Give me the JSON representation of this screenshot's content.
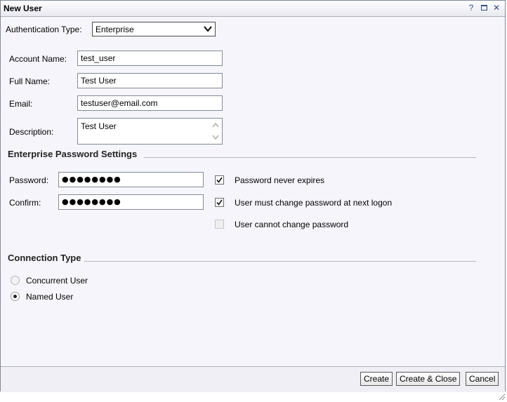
{
  "dialog": {
    "title": "New User",
    "title_icons": [
      "help-icon",
      "maximize-icon",
      "close-icon"
    ],
    "help_glyph": "?",
    "close_glyph": "✕"
  },
  "auth": {
    "label": "Authentication Type:",
    "selected": "Enterprise"
  },
  "fields": {
    "account_name": {
      "label": "Account Name:",
      "value": "test_user"
    },
    "full_name": {
      "label": "Full Name:",
      "value": "Test User"
    },
    "email": {
      "label": "Email:",
      "value": "testuser@email.com"
    },
    "description": {
      "label": "Description:",
      "value": "Test User"
    }
  },
  "password_section": {
    "title": "Enterprise Password Settings",
    "password_label": "Password:",
    "password_mask": "●●●●●●●●",
    "confirm_label": "Confirm:",
    "confirm_mask": "●●●●●●●●",
    "options": [
      {
        "label": "Password never expires",
        "checked": true,
        "enabled": true
      },
      {
        "label": "User must change password at next logon",
        "checked": true,
        "enabled": true
      },
      {
        "label": "User cannot change password",
        "checked": false,
        "enabled": false
      }
    ]
  },
  "connection": {
    "title": "Connection Type",
    "options": [
      {
        "label": "Concurrent User",
        "selected": false
      },
      {
        "label": "Named User",
        "selected": true
      }
    ]
  },
  "buttons": {
    "create": "Create",
    "create_close": "Create & Close",
    "cancel": "Cancel"
  },
  "colors": {
    "dialog_bg": "#f6f5fb",
    "title_icon": "#2c4f8c",
    "border": "#7f8a99"
  }
}
